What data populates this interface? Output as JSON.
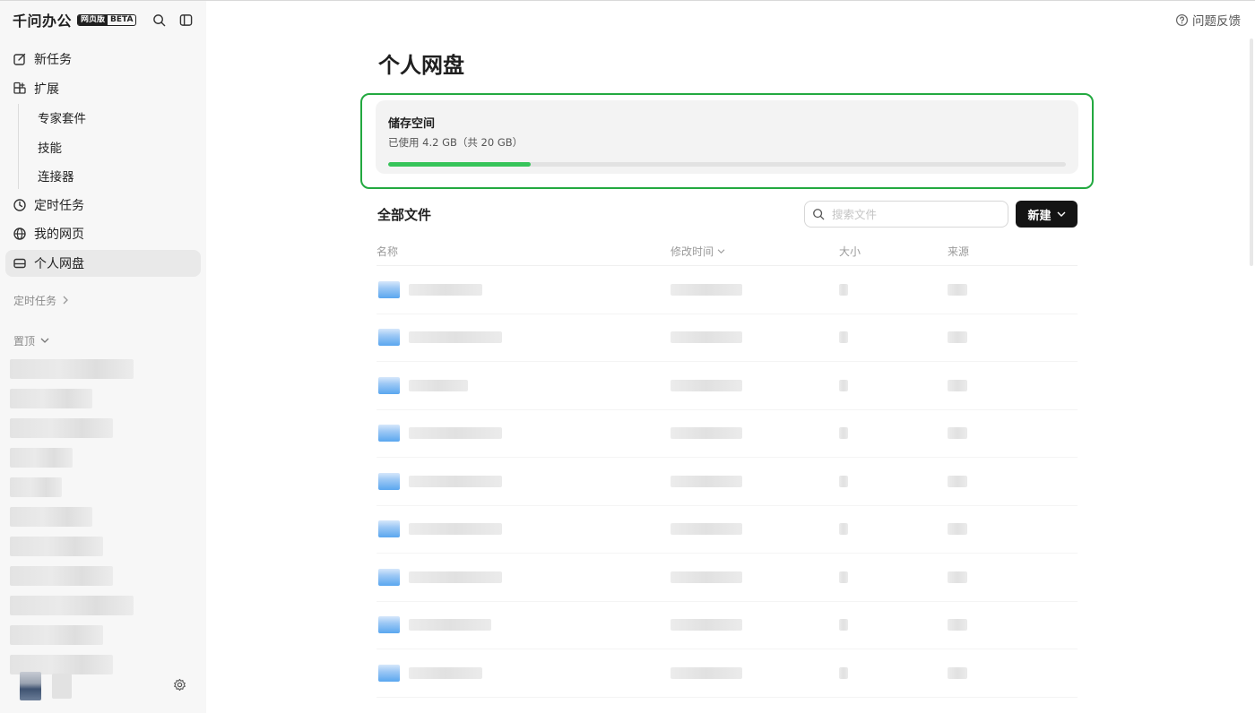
{
  "brand": {
    "name": "千问办公",
    "badge_primary": "网页版",
    "badge_secondary": "BETA"
  },
  "sidebar": {
    "items": [
      {
        "label": "新任务",
        "icon": "edit-icon"
      },
      {
        "label": "扩展",
        "icon": "grid-plus-icon"
      }
    ],
    "extension_subitems": [
      "专家套件",
      "技能",
      "连接器"
    ],
    "items_after": [
      {
        "label": "定时任务",
        "icon": "clock-icon"
      },
      {
        "label": "我的网页",
        "icon": "globe-icon"
      },
      {
        "label": "个人网盘",
        "icon": "drive-icon",
        "active": true
      }
    ],
    "section_scheduled": "定时任务",
    "section_pinned": "置顶"
  },
  "header": {
    "feedback_label": "问题反馈"
  },
  "main": {
    "title": "个人网盘",
    "storage": {
      "title": "储存空间",
      "usage_text": "已使用 4.2 GB（共 20 GB）",
      "used_fraction": 0.21,
      "accent": "#37c45a"
    },
    "files": {
      "title": "全部文件",
      "search_placeholder": "搜索文件",
      "new_button_label": "新建",
      "columns": {
        "name": "名称",
        "modified": "修改时间",
        "size": "大小",
        "source": "来源"
      }
    }
  }
}
